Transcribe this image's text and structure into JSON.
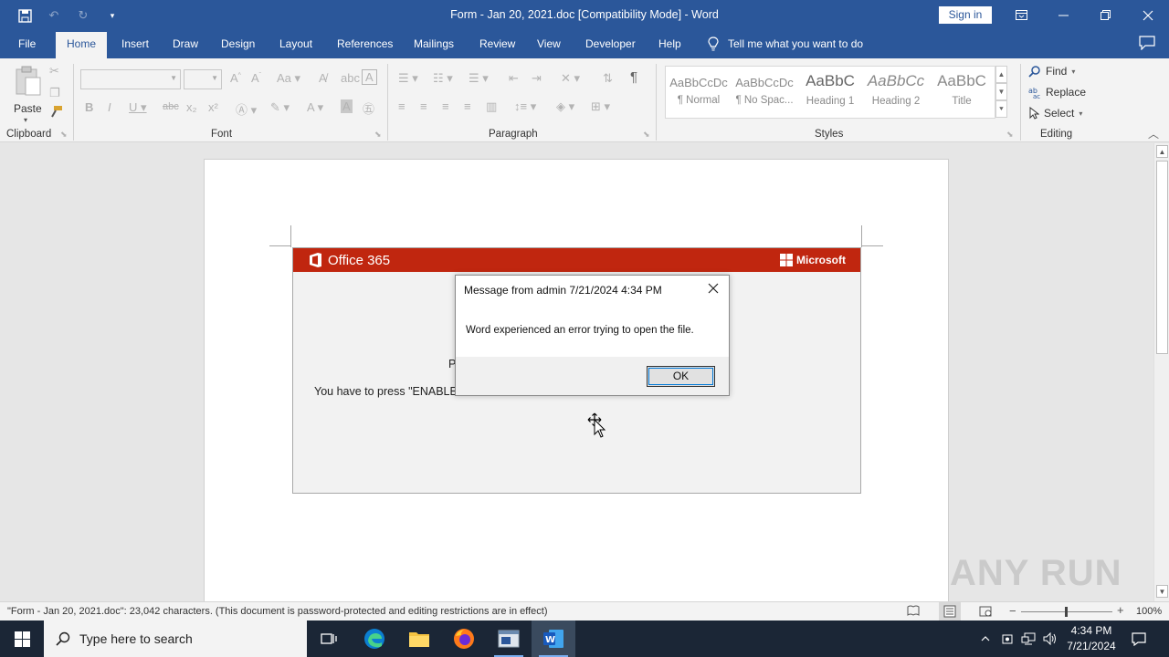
{
  "window": {
    "title": "Form - Jan 20, 2021.doc [Compatibility Mode]  -  Word",
    "sign_in": "Sign in"
  },
  "tabs": [
    "File",
    "Home",
    "Insert",
    "Draw",
    "Design",
    "Layout",
    "References",
    "Mailings",
    "Review",
    "View",
    "Developer",
    "Help"
  ],
  "tell_me": "Tell me what you want to do",
  "ribbon": {
    "clipboard": {
      "label": "Clipboard",
      "paste": "Paste"
    },
    "font": {
      "label": "Font"
    },
    "paragraph": {
      "label": "Paragraph"
    },
    "styles": {
      "label": "Styles",
      "items": [
        {
          "sample": "AaBbCcDc",
          "name": "¶ Normal"
        },
        {
          "sample": "AaBbCcDc",
          "name": "¶ No Spac..."
        },
        {
          "sample": "AaBbC",
          "name": "Heading 1"
        },
        {
          "sample": "AaBbCc",
          "name": "Heading 2"
        },
        {
          "sample": "AaBbC",
          "name": "Title"
        }
      ]
    },
    "editing": {
      "label": "Editing",
      "find": "Find",
      "replace": "Replace",
      "select": "Select"
    }
  },
  "document": {
    "banner_left": "Office 365",
    "banner_right": "Microsoft",
    "line1": "P",
    "line2": "You have to press \"ENABLE                                                                              view this document."
  },
  "dialog": {
    "title": "Message from admin 7/21/2024 4:34 PM",
    "message": "Word experienced an error trying to open the file.",
    "ok": "OK"
  },
  "statusbar": {
    "text": "\"Form - Jan 20, 2021.doc\": 23,042 characters.  (This document is password-protected and editing restrictions are in effect)",
    "zoom": "100%"
  },
  "taskbar": {
    "search_placeholder": "Type here to search",
    "time": "4:34 PM",
    "date": "7/21/2024"
  },
  "watermark": "ANY RUN",
  "colors": {
    "word_blue": "#2b579a",
    "office_red": "#c0260f",
    "taskbar": "#1b2636"
  }
}
